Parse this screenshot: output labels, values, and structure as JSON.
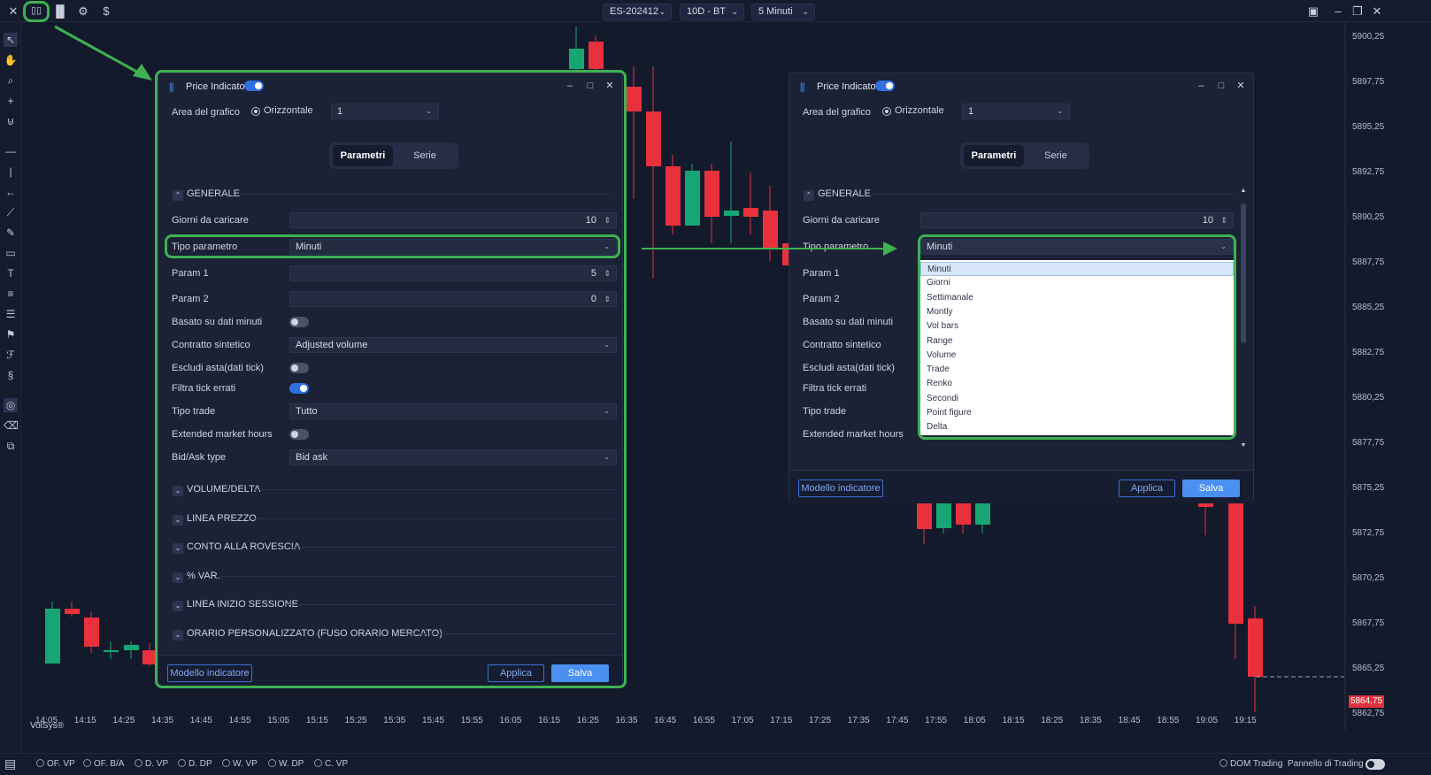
{
  "toolbar": {
    "icons": [
      "close-icon",
      "layout-icon",
      "bars-icon",
      "settings-icon",
      "dollar-icon"
    ],
    "symbol": "ES-202412",
    "template": "10D - BT",
    "timeframe": "5 Minuti"
  },
  "y_axis": [
    "5900,25",
    "5897,75",
    "5895,25",
    "5892,75",
    "5890,25",
    "5887,75",
    "5885,25",
    "5882,75",
    "5880,25",
    "5877,75",
    "5875,25",
    "5872,75",
    "5870,25",
    "5867,75",
    "5865,25",
    "5862,75"
  ],
  "current_price": "5864,75",
  "x_axis": [
    "14:05",
    "14:15",
    "14:25",
    "14:35",
    "14:45",
    "14:55",
    "15:05",
    "15:15",
    "15:25",
    "15:35",
    "15:45",
    "15:55",
    "16:05",
    "16:15",
    "16:25",
    "16:35",
    "16:45",
    "16:55",
    "17:05",
    "17:15",
    "17:25",
    "17:35",
    "17:45",
    "17:55",
    "18:05",
    "18:15",
    "18:25",
    "18:35",
    "18:45",
    "18:55",
    "19:05",
    "19:15"
  ],
  "watermark": "VolSys®",
  "bottom": {
    "items": [
      "OF. VP",
      "OF. B/A",
      "D. VP",
      "D. DP",
      "W. VP",
      "W. DP",
      "C. VP"
    ],
    "dom_trading": "DOM Trading",
    "pannello": "Pannello di Trading"
  },
  "dialog": {
    "title": "Price Indicator",
    "area_label": "Area del grafico",
    "area_option": "Orizzontale",
    "area_value": "1",
    "tabs": [
      "Parametri",
      "Serie"
    ],
    "section_generale": "GENERALE",
    "giorni_label": "Giorni da caricare",
    "giorni_value": "10",
    "tipo_param_label": "Tipo parametro",
    "tipo_param_value": "Minuti",
    "param1_label": "Param 1",
    "param1_value": "5",
    "param2_label": "Param 2",
    "param2_value": "0",
    "basato_label": "Basato su dati minuti",
    "contratto_label": "Contratto sintetico",
    "contratto_value": "Adjusted volume",
    "escludi_label": "Escludi asta(dati tick)",
    "filtra_label": "Filtra tick errati",
    "tipo_trade_label": "Tipo trade",
    "tipo_trade_value": "Tutto",
    "extended_label": "Extended market hours",
    "bidask_label": "Bid/Ask type",
    "bidask_value": "Bid ask",
    "sections": [
      "VOLUME/DELTA",
      "LINEA PREZZO",
      "CONTO ALLA ROVESCIA",
      "% VAR.",
      "LINEA INIZIO SESSIONE",
      "ORARIO PERSONALIZZATO (FUSO ORARIO MERCATO)"
    ],
    "btn_modello": "Modello indicatore",
    "btn_applica": "Applica",
    "btn_salva": "Salva"
  },
  "dropdown_options": [
    "Minuti",
    "Giorni",
    "Settimanale",
    "Montly",
    "Vol bars",
    "Range",
    "Volume",
    "Trade",
    "Renko",
    "Secondi",
    "Point figure",
    "Delta"
  ],
  "colors": {
    "up": "#17a673",
    "down": "#e8313d",
    "highlight": "#3fb151",
    "accent": "#4a90f0"
  }
}
